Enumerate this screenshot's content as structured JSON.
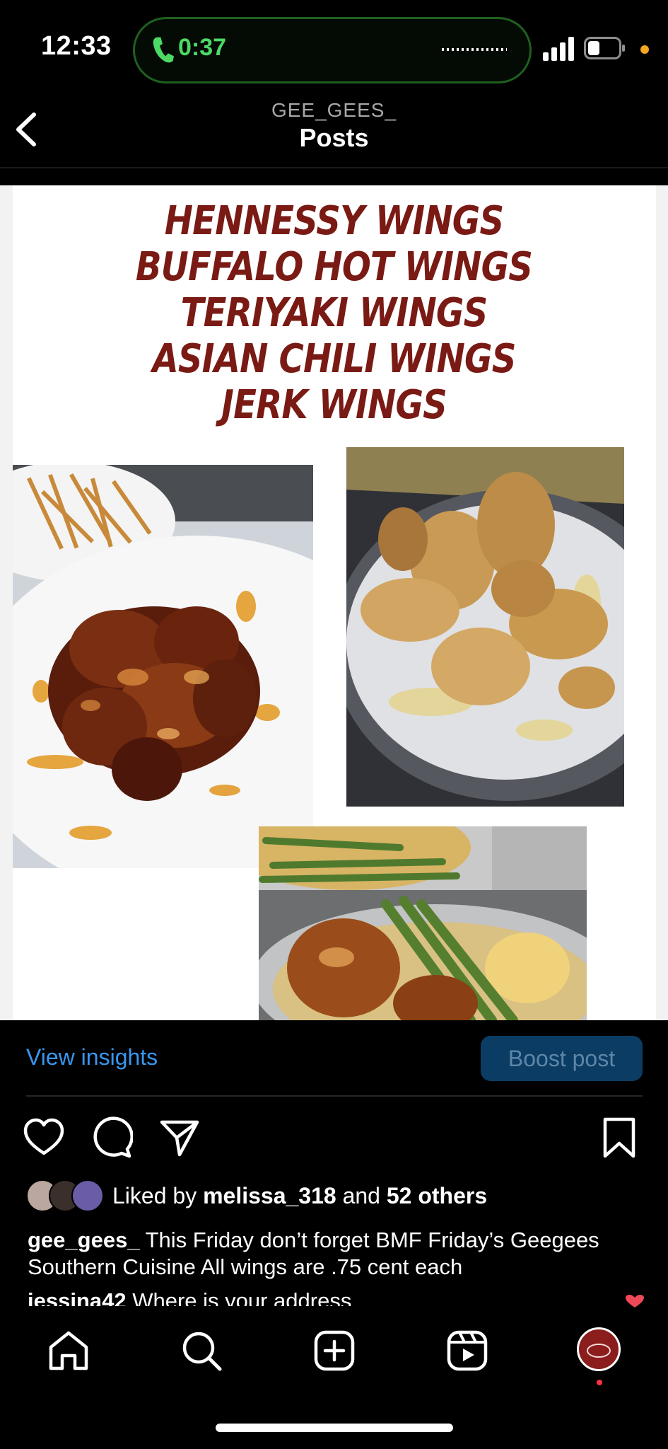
{
  "status_bar": {
    "time": "12:33",
    "call_timer": "0:37",
    "icons": [
      "phone-icon",
      "signal-icon",
      "battery-icon"
    ]
  },
  "header": {
    "username": "GEE_GEES_",
    "title": "Posts"
  },
  "post": {
    "image_text": [
      "HENNESSY WINGS",
      "BUFFALO HOT WINGS",
      "TERIYAKI WINGS",
      "ASIAN CHILI WINGS",
      "JERK WINGS"
    ]
  },
  "insights": {
    "view_label": "View insights",
    "boost_label": "Boost post"
  },
  "likes": {
    "prefix": "Liked by ",
    "user": "melissa_318",
    "middle": " and ",
    "others": "52 others"
  },
  "caption": {
    "username": "gee_gees_",
    "text": " This Friday don’t forget BMF Friday’s Geegees Southern Cuisine All wings are .75 cent each"
  },
  "comment": {
    "username": "jessina42",
    "text": " Where is your address"
  },
  "colors": {
    "link_blue": "#3897f0",
    "boost_bg": "#0b3d64",
    "call_green": "#4cd964",
    "menu_red": "#7a1a14"
  }
}
